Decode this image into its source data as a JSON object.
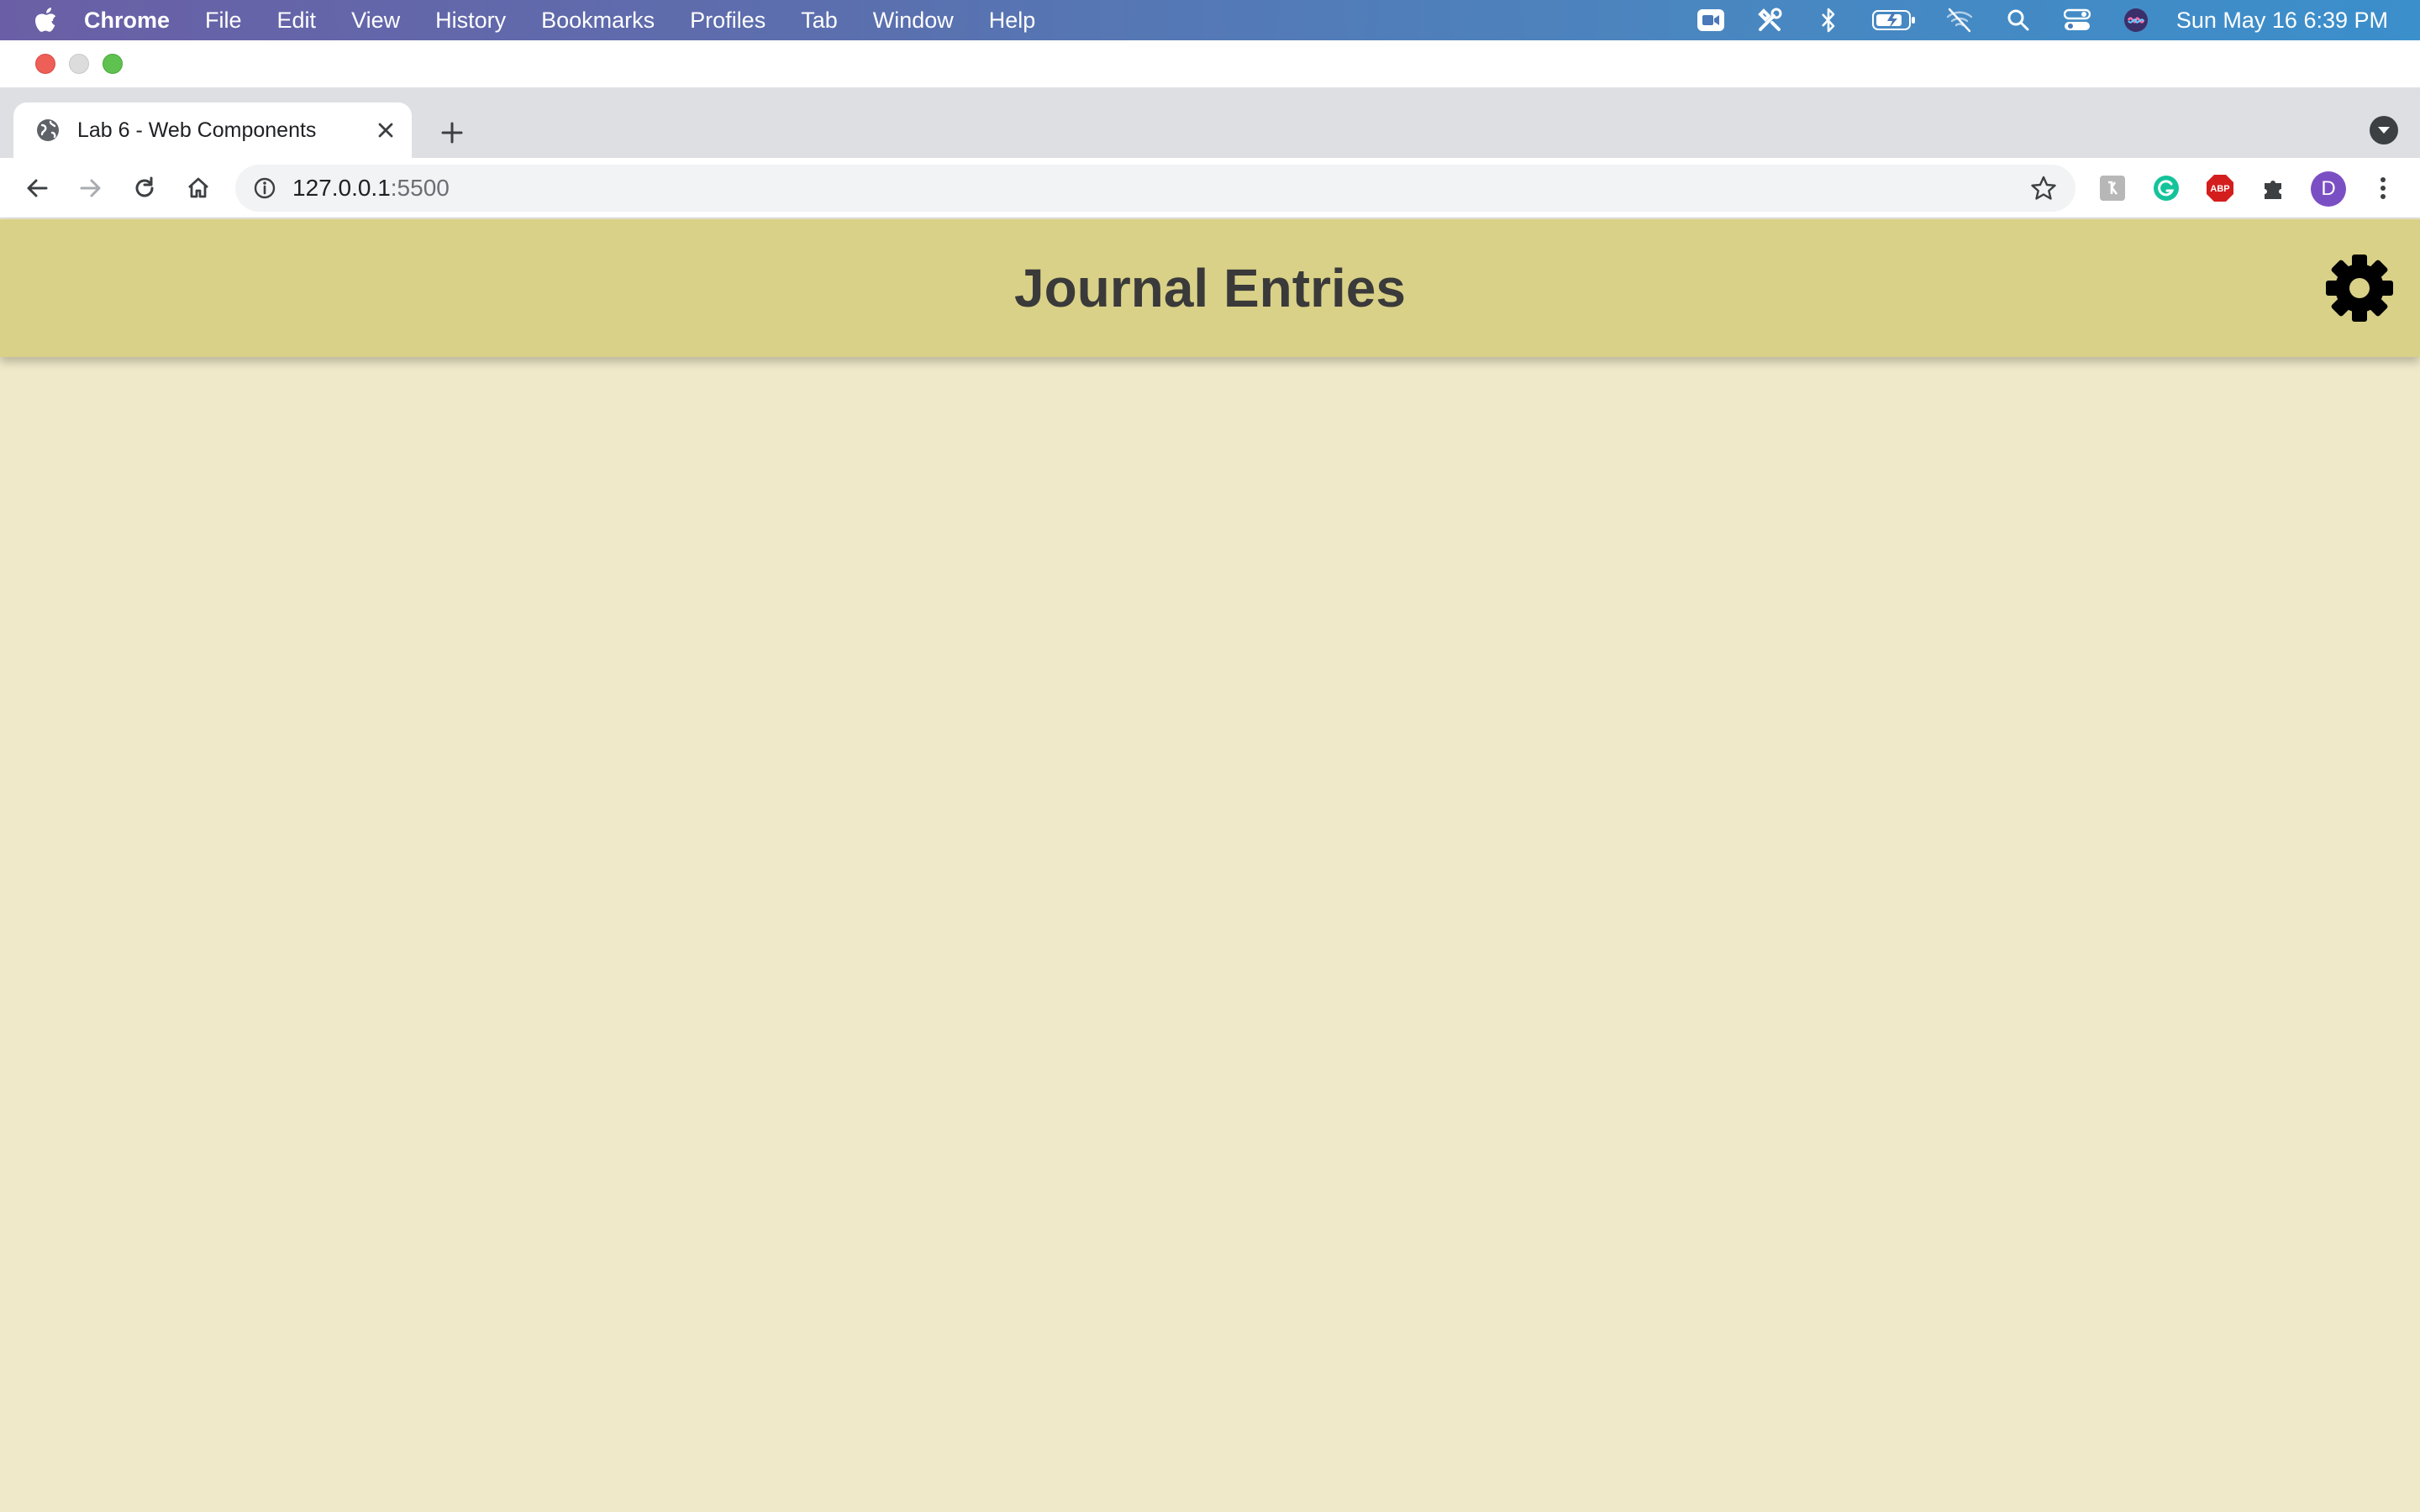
{
  "menubar": {
    "app_name": "Chrome",
    "items": [
      "File",
      "Edit",
      "View",
      "History",
      "Bookmarks",
      "Profiles",
      "Tab",
      "Window",
      "Help"
    ],
    "status_icons": [
      "facetime-icon",
      "tools-icon",
      "bluetooth-icon",
      "battery-icon",
      "wifi-off-icon",
      "spotlight-icon",
      "control-center-icon",
      "siri-icon"
    ],
    "clock": "Sun May 16  6:39 PM"
  },
  "browser": {
    "tab_title": "Lab 6 - Web Components",
    "url_host": "127.0.0.1",
    "url_port": ":5500",
    "profile_initial": "D",
    "extensions": [
      "extension-gray-icon",
      "grammarly-icon",
      "adblock-icon",
      "puzzle-icon"
    ],
    "adblock_label": "ABP"
  },
  "page": {
    "title": "Journal Entries",
    "header_color": "#d9d188",
    "background_color": "#efe9c9"
  }
}
